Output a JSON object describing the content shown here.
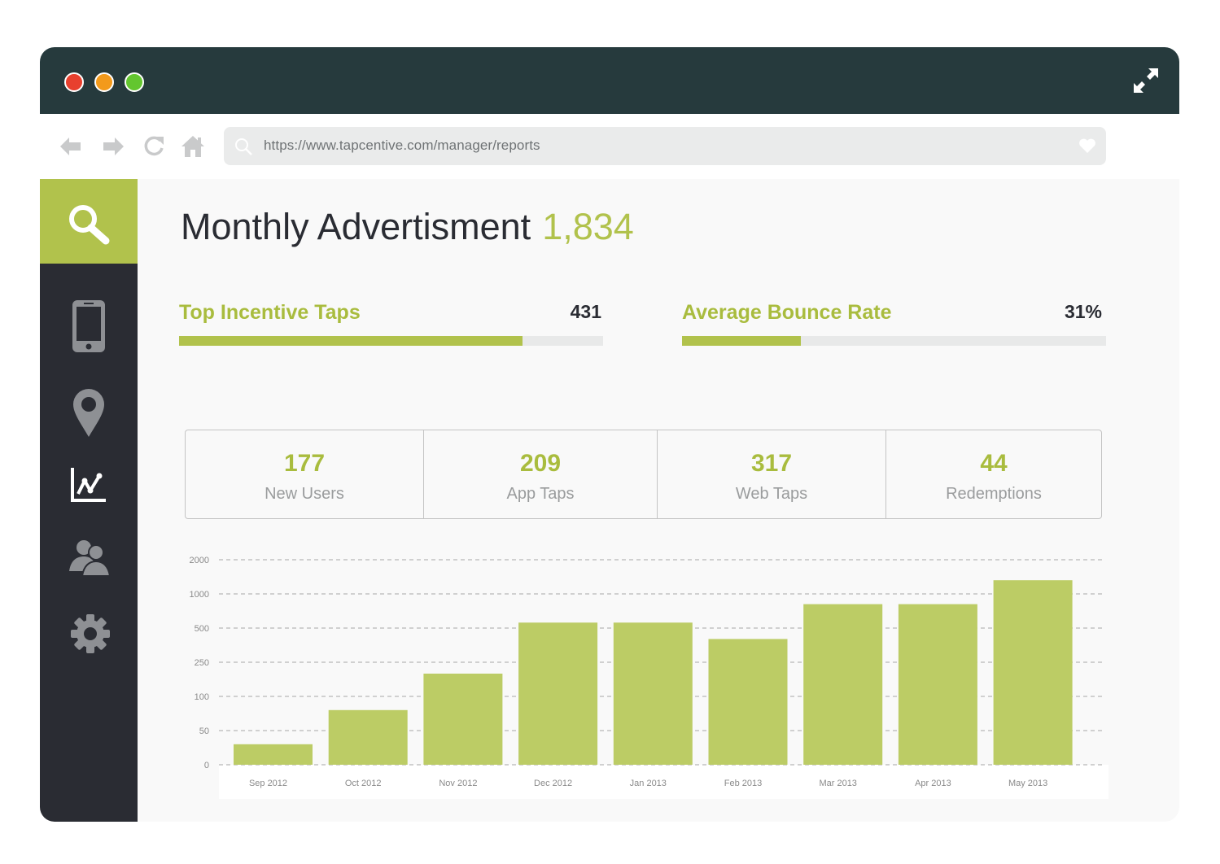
{
  "browser": {
    "url": "https://www.tapcentive.com/manager/reports"
  },
  "sidebar": {
    "items": [
      {
        "icon": "search-icon",
        "active": true
      },
      {
        "icon": "mobile-phone-icon"
      },
      {
        "icon": "location-pin-icon"
      },
      {
        "icon": "line-chart-icon"
      },
      {
        "icon": "users-icon"
      },
      {
        "icon": "gear-icon"
      }
    ]
  },
  "colors": {
    "accent": "#b1c24c",
    "titlebar": "#263a3d",
    "sidebar": "#2a2c33",
    "text": "#2a2c33"
  },
  "header": {
    "title": "Monthly Advertisment",
    "count": "1,834"
  },
  "metrics": [
    {
      "label": "Top Incentive Taps",
      "value": "431",
      "progress": 0.81
    },
    {
      "label": "Average Bounce Rate",
      "value": "31%",
      "progress": 0.28
    }
  ],
  "stats": [
    {
      "value": "177",
      "label": "New Users"
    },
    {
      "value": "209",
      "label": "App Taps"
    },
    {
      "value": "317",
      "label": "Web Taps"
    },
    {
      "value": "44",
      "label": "Redemptions"
    }
  ],
  "chart_data": {
    "type": "bar",
    "categories": [
      "Sep 2012",
      "Oct 2012",
      "Nov 2012",
      "Dec 2012",
      "Jan 2013",
      "Feb 2013",
      "Mar 2013",
      "Apr 2013",
      "May 2013"
    ],
    "values": [
      30,
      80,
      200,
      580,
      580,
      420,
      850,
      850,
      1400
    ],
    "yticks": [
      "0",
      "50",
      "100",
      "250",
      "500",
      "1000",
      "2000"
    ],
    "ytick_values": [
      0,
      50,
      100,
      250,
      500,
      1000,
      2000
    ],
    "ylim": [
      0,
      2000
    ],
    "grid": true,
    "title": "",
    "xlabel": "",
    "ylabel": ""
  }
}
